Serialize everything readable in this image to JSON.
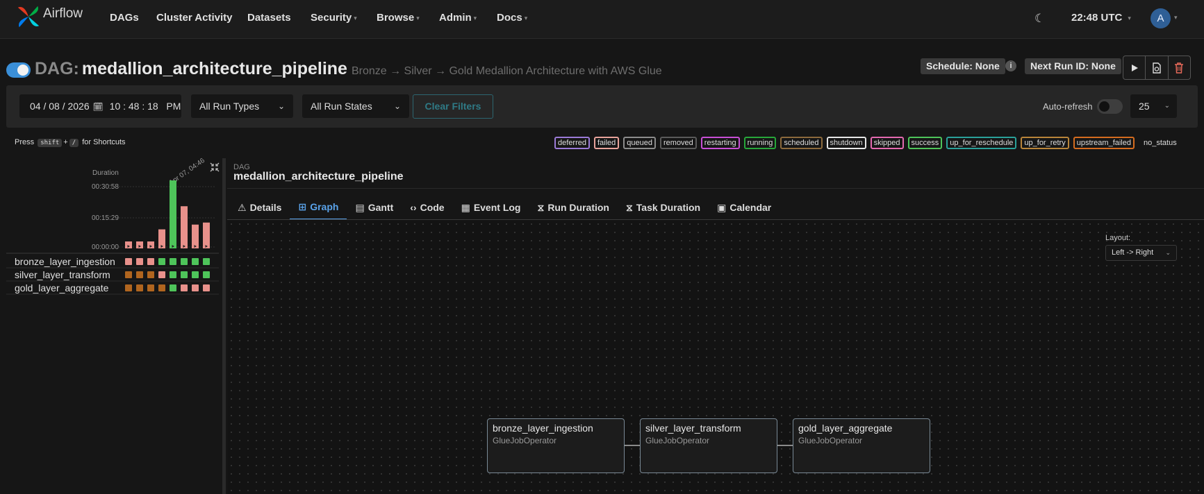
{
  "nav": {
    "brand": "Airflow",
    "items": [
      {
        "label": "DAGs",
        "dropdown": false
      },
      {
        "label": "Cluster Activity",
        "dropdown": false
      },
      {
        "label": "Datasets",
        "dropdown": false
      },
      {
        "label": "Security",
        "dropdown": true
      },
      {
        "label": "Browse",
        "dropdown": true
      },
      {
        "label": "Admin",
        "dropdown": true
      },
      {
        "label": "Docs",
        "dropdown": true
      }
    ],
    "time": "22:48 UTC",
    "user_initial": "A"
  },
  "dag": {
    "prefix": "DAG:",
    "id": "medallion_architecture_pipeline",
    "description": "Bronze → Silver → Gold Medallion Architecture with AWS Glue",
    "schedule": "Schedule: None",
    "next_run": "Next Run ID: None"
  },
  "filters": {
    "date": "04 / 08 / 2026",
    "time": "10 : 48 : 18   PM",
    "run_types": "All Run Types",
    "run_states": "All Run States",
    "clear_label": "Clear Filters",
    "autorefresh_label": "Auto-refresh",
    "page_size": "25"
  },
  "shortcuts": {
    "press": "Press",
    "key1": "shift",
    "plus": "+",
    "key2": "/",
    "suffix": "for Shortcuts"
  },
  "legend": [
    {
      "label": "deferred",
      "color": "#9c7bd8"
    },
    {
      "label": "failed",
      "color": "#e8a39b"
    },
    {
      "label": "queued",
      "color": "#8c8c8c"
    },
    {
      "label": "removed",
      "color": "#5a5a5a"
    },
    {
      "label": "restarting",
      "color": "#c94fd6"
    },
    {
      "label": "running",
      "color": "#27a73a"
    },
    {
      "label": "scheduled",
      "color": "#8c6a3c"
    },
    {
      "label": "shutdown",
      "color": "#e6e6e6"
    },
    {
      "label": "skipped",
      "color": "#e46ab0"
    },
    {
      "label": "success",
      "color": "#4ec45a"
    },
    {
      "label": "up_for_reschedule",
      "color": "#2aa19a"
    },
    {
      "label": "up_for_retry",
      "color": "#b9853a"
    },
    {
      "label": "upstream_failed",
      "color": "#d56c1f"
    },
    {
      "label": "no_status",
      "color": "transparent"
    }
  ],
  "grid": {
    "duration_label": "Duration",
    "y_ticks": [
      "00:30:58",
      "00:15:29",
      "00:00:00"
    ],
    "run_label": "Apr 07, 04:46",
    "durations": [
      0.04,
      0.04,
      0.04,
      0.28,
      1.0,
      0.62,
      0.35,
      0.38
    ],
    "bar_states": [
      "failed",
      "failed",
      "failed",
      "failed",
      "success",
      "failed",
      "failed",
      "failed"
    ],
    "tasks": [
      {
        "name": "bronze_layer_ingestion",
        "states": [
          "failed",
          "failed",
          "failed",
          "success",
          "success",
          "success",
          "success",
          "success"
        ]
      },
      {
        "name": "silver_layer_transform",
        "states": [
          "upstream_failed",
          "upstream_failed",
          "upstream_failed",
          "failed",
          "success",
          "success",
          "success",
          "success"
        ]
      },
      {
        "name": "gold_layer_aggregate",
        "states": [
          "upstream_failed",
          "upstream_failed",
          "upstream_failed",
          "upstream_failed",
          "success",
          "failed",
          "failed",
          "failed"
        ]
      }
    ],
    "colors": {
      "failed": "#e8918b",
      "success": "#4ec45a",
      "upstream_failed": "#b0651f"
    }
  },
  "panel": {
    "label": "DAG",
    "title": "medallion_architecture_pipeline",
    "tabs": [
      {
        "label": "Details",
        "icon": "⚠",
        "active": false
      },
      {
        "label": "Graph",
        "icon": "⊞",
        "active": true
      },
      {
        "label": "Gantt",
        "icon": "▤",
        "active": false
      },
      {
        "label": "Code",
        "icon": "‹›",
        "active": false
      },
      {
        "label": "Event Log",
        "icon": "▦",
        "active": false
      },
      {
        "label": "Run Duration",
        "icon": "⧖",
        "active": false
      },
      {
        "label": "Task Duration",
        "icon": "⧖",
        "active": false
      },
      {
        "label": "Calendar",
        "icon": "▣",
        "active": false
      }
    ]
  },
  "graph": {
    "layout_label": "Layout:",
    "layout_value": "Left -> Right",
    "nodes": [
      {
        "task": "bronze_layer_ingestion",
        "operator": "GlueJobOperator"
      },
      {
        "task": "silver_layer_transform",
        "operator": "GlueJobOperator"
      },
      {
        "task": "gold_layer_aggregate",
        "operator": "GlueJobOperator"
      }
    ]
  }
}
